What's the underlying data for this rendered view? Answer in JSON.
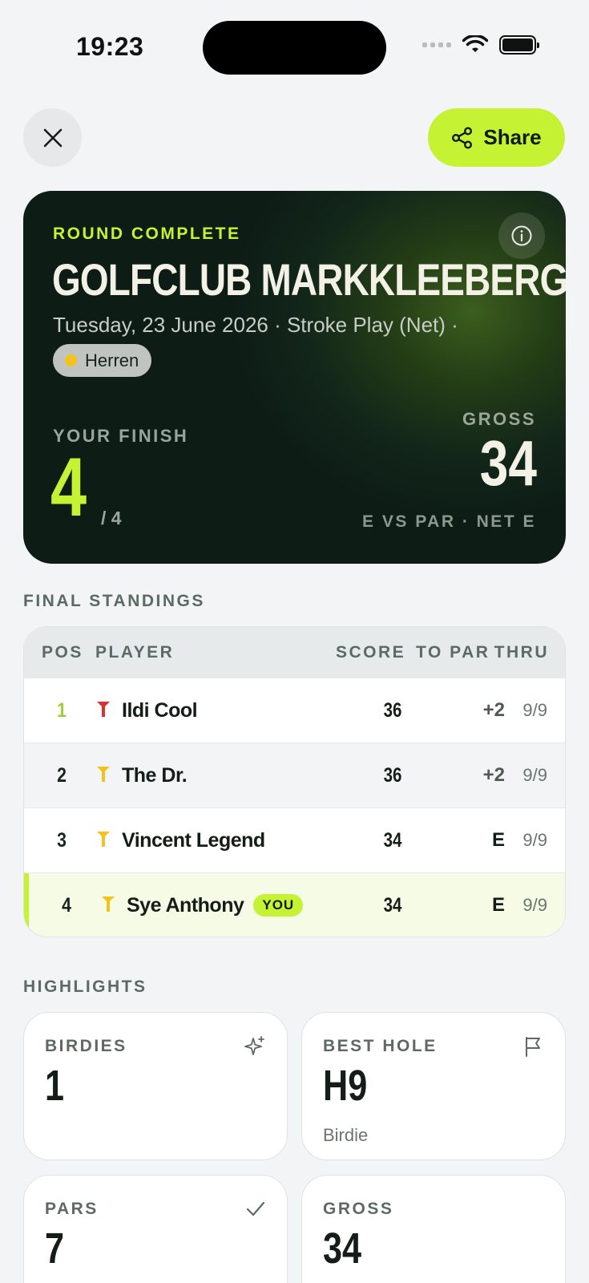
{
  "status_bar": {
    "time": "19:23"
  },
  "actions": {
    "share_label": "Share"
  },
  "hero": {
    "kicker": "ROUND COMPLETE",
    "title": "GOLFCLUB MARKKLEEBERG",
    "subtitle": "Tuesday, 23 June 2026 · Stroke Play (Net) ·",
    "tee": "Herren",
    "finish_label": "YOUR FINISH",
    "finish_value": "4",
    "finish_of": "/ 4",
    "gross_label": "GROSS",
    "gross_value": "34",
    "gross_sub": "E VS PAR · NET E",
    "accent_color": "#c6f234"
  },
  "standings": {
    "section_label": "FINAL STANDINGS",
    "columns": {
      "pos": "POS",
      "player": "PLAYER",
      "score": "SCORE",
      "to_par": "TO PAR",
      "thru": "THRU"
    },
    "rows": [
      {
        "pos": "1",
        "player": "Ildi Cool",
        "tee_color": "#d8322a",
        "score": "36",
        "to_par": "+2",
        "thru": "9/9"
      },
      {
        "pos": "2",
        "player": "The Dr.",
        "tee_color": "#f4c21b",
        "score": "36",
        "to_par": "+2",
        "thru": "9/9"
      },
      {
        "pos": "3",
        "player": "Vincent Legend",
        "tee_color": "#f4c21b",
        "score": "34",
        "to_par": "E",
        "thru": "9/9"
      },
      {
        "pos": "4",
        "player": "Sye Anthony",
        "tee_color": "#f4c21b",
        "score": "34",
        "to_par": "E",
        "thru": "9/9",
        "badge": "YOU"
      }
    ]
  },
  "highlights": {
    "section_label": "HIGHLIGHTS",
    "cards": [
      {
        "label": "BIRDIES",
        "value": "1",
        "icon": "sparkle-icon"
      },
      {
        "label": "BEST HOLE",
        "value": "H9",
        "sub": "Birdie",
        "icon": "flag-icon"
      },
      {
        "label": "PARS",
        "value": "7",
        "icon": "check-icon"
      },
      {
        "label": "GROSS",
        "value": "34"
      }
    ]
  }
}
